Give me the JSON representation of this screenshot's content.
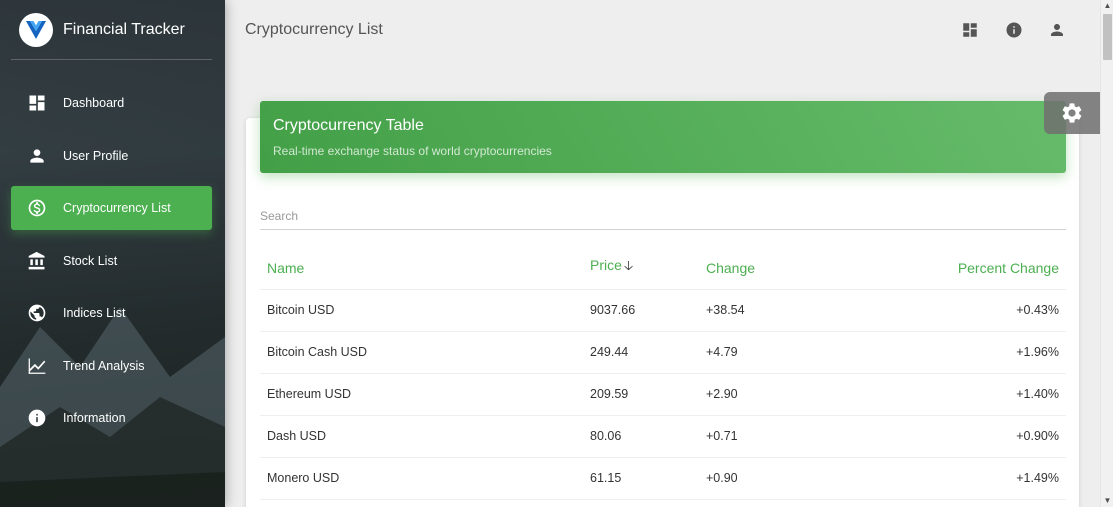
{
  "app": {
    "title": "Financial Tracker"
  },
  "sidebar": {
    "items": [
      {
        "label": "Dashboard",
        "icon": "dashboard-icon",
        "active": false
      },
      {
        "label": "User Profile",
        "icon": "person-icon",
        "active": false
      },
      {
        "label": "Cryptocurrency List",
        "icon": "dollar-circle-icon",
        "active": true
      },
      {
        "label": "Stock List",
        "icon": "bank-icon",
        "active": false
      },
      {
        "label": "Indices List",
        "icon": "globe-icon",
        "active": false
      },
      {
        "label": "Trend Analysis",
        "icon": "line-chart-icon",
        "active": false
      },
      {
        "label": "Information",
        "icon": "info-icon",
        "active": false
      }
    ]
  },
  "header": {
    "title": "Cryptocurrency List",
    "icons": [
      "dashboard-icon",
      "info-icon",
      "person-icon"
    ]
  },
  "card": {
    "title": "Cryptocurrency Table",
    "subtitle": "Real-time exchange status of world cryptocurrencies"
  },
  "search": {
    "placeholder": "Search",
    "value": ""
  },
  "table": {
    "columns": [
      "Name",
      "Price",
      "Change",
      "Percent Change"
    ],
    "sorted_by": "Price",
    "sort_direction": "descending",
    "rows": [
      {
        "name": "Bitcoin USD",
        "price": "9037.66",
        "change": "+38.54",
        "percent_change": "+0.43%"
      },
      {
        "name": "Bitcoin Cash USD",
        "price": "249.44",
        "change": "+4.79",
        "percent_change": "+1.96%"
      },
      {
        "name": "Ethereum USD",
        "price": "209.59",
        "change": "+2.90",
        "percent_change": "+1.40%"
      },
      {
        "name": "Dash USD",
        "price": "80.06",
        "change": "+0.71",
        "percent_change": "+0.90%"
      },
      {
        "name": "Monero USD",
        "price": "61.15",
        "change": "+0.90",
        "percent_change": "+1.49%"
      }
    ]
  },
  "colors": {
    "accent": "#4caf50",
    "sidebar_bg": "#2e383c",
    "page_bg": "#eeeeee"
  }
}
